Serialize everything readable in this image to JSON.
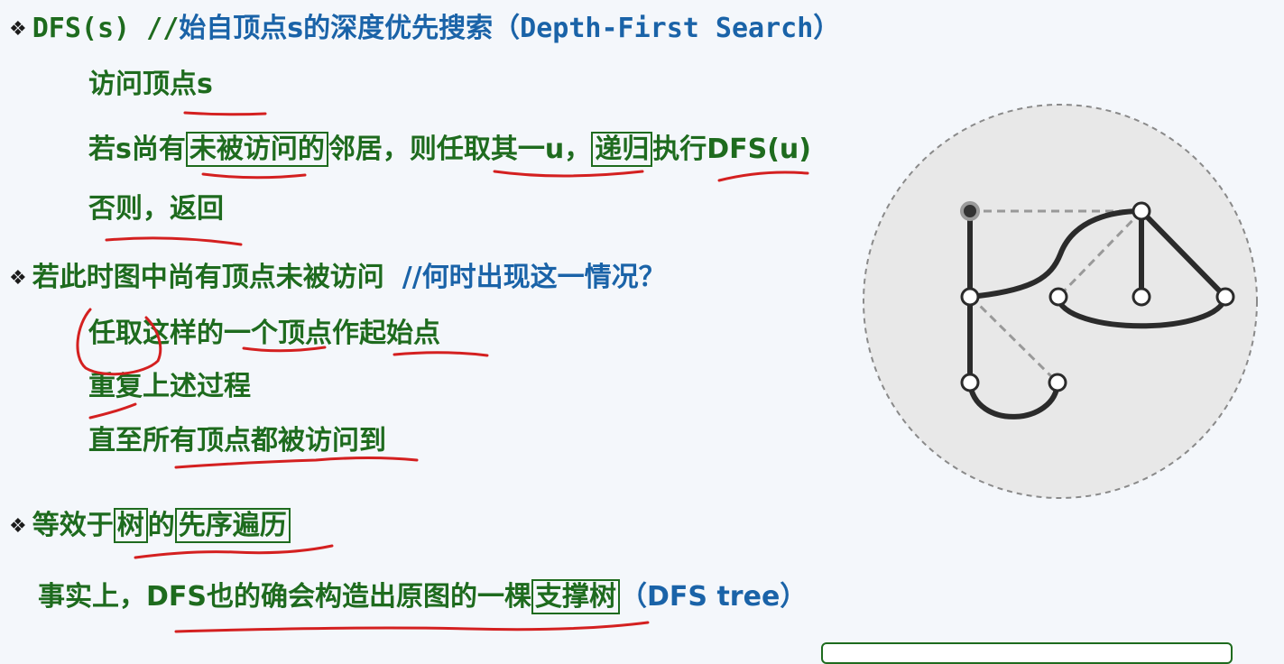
{
  "lines": {
    "l1": {
      "code": "DFS(s) //",
      "cn": "始自顶点s的深度优先搜索",
      "paren_open": "（",
      "en": "Depth-First Search",
      "paren_close": "）"
    },
    "l2": {
      "text": "访问顶点s"
    },
    "l3": {
      "a": "若s尚有",
      "box1": "未被访问的",
      "b": "邻居，则任取其一u，",
      "box2": "递归",
      "c": "执行DFS(u)"
    },
    "l4": {
      "text": "否则，返回"
    },
    "l5": {
      "a": "若此时图中尚有顶点未被访问",
      "b": "//何时出现这一情况？"
    },
    "l6": {
      "text": "任取这样的一个顶点作起始点"
    },
    "l7": {
      "text": "重复上述过程"
    },
    "l8": {
      "text": "直至所有顶点都被访问到"
    },
    "l9": {
      "a": "等效于",
      "box1": "树",
      "b": "的",
      "box2": "先序遍历"
    },
    "l10": {
      "a": "事实上，DFS也的确会构造出原图的一棵",
      "box": "支撑树",
      "b": "（DFS tree）"
    }
  },
  "bullet_icon": "diamond-bullet-icon",
  "colors": {
    "green": "#1e6b1e",
    "blue": "#1a63a8",
    "ink": "#d42020",
    "edge": "#2b2b2b",
    "dashed": "#999999",
    "circle": "#e8e8e8"
  }
}
